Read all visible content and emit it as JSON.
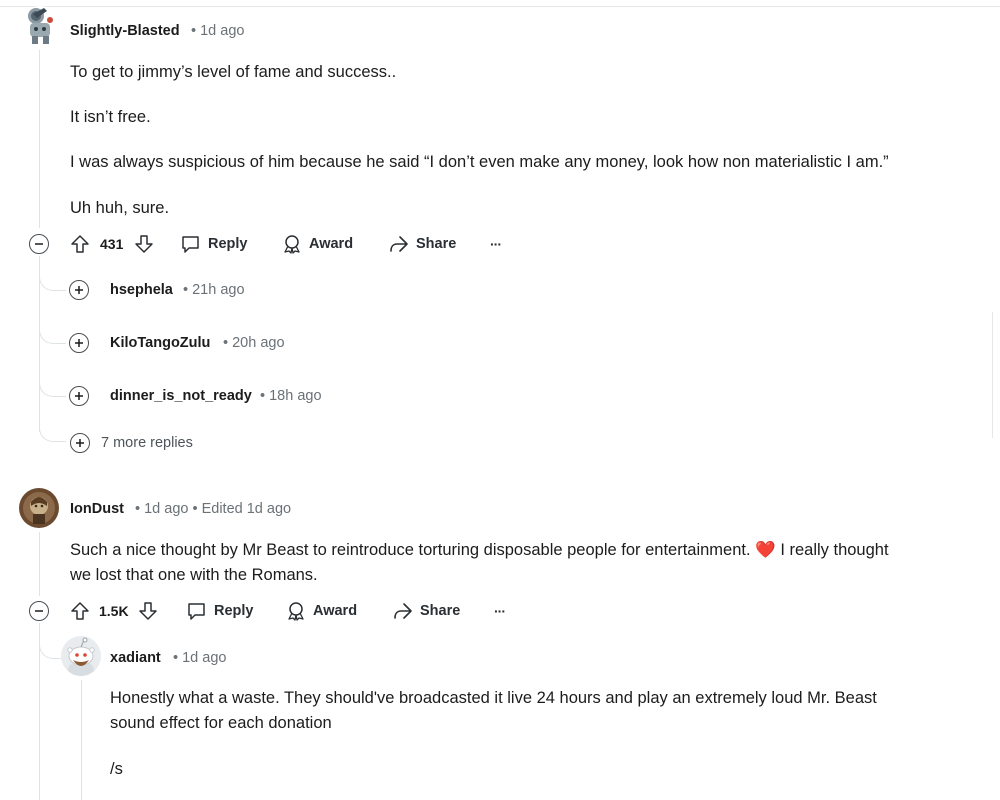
{
  "comments": [
    {
      "author": "Slightly-Blasted",
      "time": "• 1d ago",
      "paragraphs": [
        "To get to jimmy’s level of fame and success..",
        "It isn’t free.",
        "I was always suspicious of him because he said “I don’t even make any money, look how non materialistic I am.”",
        "Uh huh, sure."
      ],
      "votes": "431",
      "actions": {
        "reply": "Reply",
        "award": "Award",
        "share": "Share",
        "more": "···"
      },
      "collapsed_replies": [
        {
          "author": "hsephela",
          "time": "• 21h ago"
        },
        {
          "author": "KiloTangoZulu",
          "time": "• 20h ago"
        },
        {
          "author": "dinner_is_not_ready",
          "time": "• 18h ago"
        }
      ],
      "more_replies": "7 more replies"
    },
    {
      "author": "IonDust",
      "time": "• 1d ago • Edited 1d ago",
      "text_before_emoji": "Such a nice thought by Mr Beast to reintroduce torturing disposable people for entertainment.",
      "emoji": "❤️",
      "text_after_emoji": "I really thought",
      "text_line2": "we lost that one with the Romans.",
      "votes": "1.5K",
      "actions": {
        "reply": "Reply",
        "award": "Award",
        "share": "Share",
        "more": "···"
      },
      "reply": {
        "author": "xadiant",
        "time": "• 1d ago",
        "line1": "Honestly what a waste. They should've broadcasted it live 24 hours and play an extremely loud Mr. Beast",
        "line2": "sound effect for each donation",
        "line3": "/s"
      }
    }
  ]
}
